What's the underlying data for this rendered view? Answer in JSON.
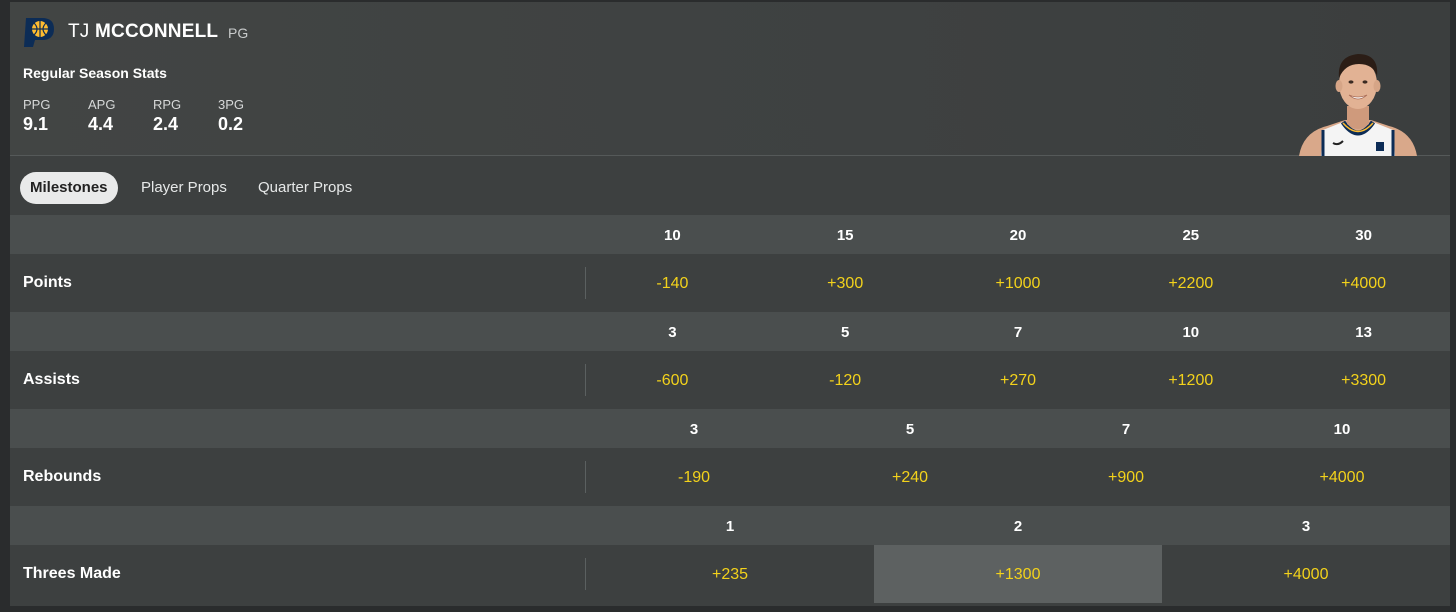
{
  "player": {
    "first_name": "TJ",
    "last_name": "MCCONNELL",
    "position": "PG"
  },
  "team_logo": {
    "icon": "pacers-logo-icon",
    "colors": {
      "navy": "#0c2c56",
      "gold": "#fdbb30"
    }
  },
  "season_stats": {
    "title": "Regular Season Stats",
    "stats": [
      {
        "label": "PPG",
        "value": "9.1"
      },
      {
        "label": "APG",
        "value": "4.4"
      },
      {
        "label": "RPG",
        "value": "2.4"
      },
      {
        "label": "3PG",
        "value": "0.2"
      }
    ]
  },
  "tabs": [
    {
      "label": "Milestones",
      "active": true
    },
    {
      "label": "Player Props",
      "active": false
    },
    {
      "label": "Quarter Props",
      "active": false
    }
  ],
  "markets": [
    {
      "label": "Points",
      "lines": [
        "10",
        "15",
        "20",
        "25",
        "30"
      ],
      "odds": [
        "-140",
        "+300",
        "+1000",
        "+2200",
        "+4000"
      ],
      "selected_index": -1
    },
    {
      "label": "Assists",
      "lines": [
        "3",
        "5",
        "7",
        "10",
        "13"
      ],
      "odds": [
        "-600",
        "-120",
        "+270",
        "+1200",
        "+3300"
      ],
      "selected_index": -1
    },
    {
      "label": "Rebounds",
      "lines": [
        "3",
        "5",
        "7",
        "10"
      ],
      "odds": [
        "-190",
        "+240",
        "+900",
        "+4000"
      ],
      "selected_index": -1
    },
    {
      "label": "Threes Made",
      "lines": [
        "1",
        "2",
        "3"
      ],
      "odds": [
        "+235",
        "+1300",
        "+4000"
      ],
      "selected_index": 1
    }
  ],
  "colors": {
    "odds": "#f3d21b",
    "panel": "#3d4040",
    "header_row": "#4a4e4e",
    "selected_cell": "#5d6161"
  }
}
